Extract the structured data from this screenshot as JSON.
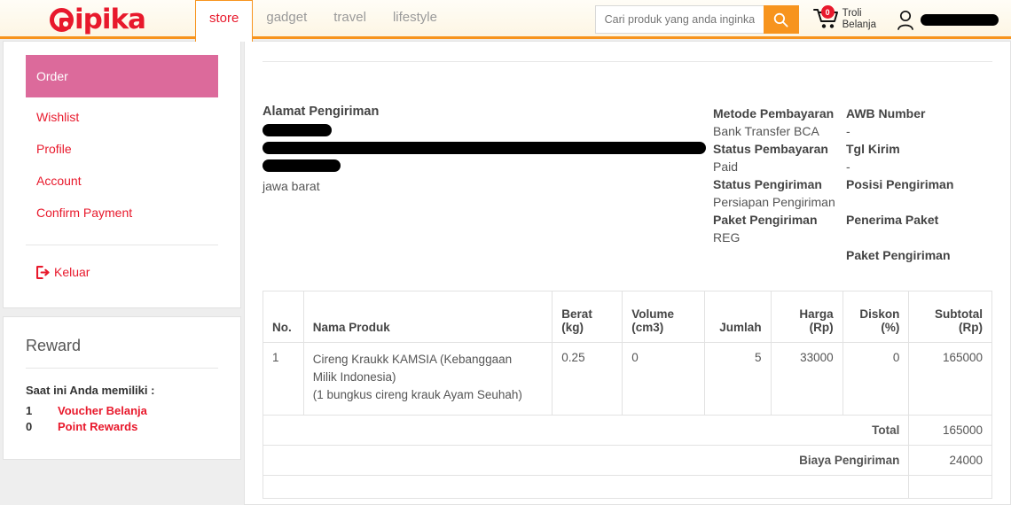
{
  "header": {
    "logo_text": "ipika",
    "nav": [
      {
        "label": "store",
        "active": true
      },
      {
        "label": "gadget",
        "active": false
      },
      {
        "label": "travel",
        "active": false
      },
      {
        "label": "lifestyle",
        "active": false
      }
    ],
    "search": {
      "placeholder": "Cari produk yang anda inginkan",
      "value": ""
    },
    "cart": {
      "count": "0",
      "label_line1": "Troli",
      "label_line2": "Belanja"
    },
    "user": {
      "name": ""
    },
    "colors": {
      "orange": "#f7941e",
      "red": "#e8192c",
      "pink": "#dc6a9b"
    }
  },
  "sidebar": {
    "items": [
      {
        "label": "Order"
      },
      {
        "label": "Wishlist"
      },
      {
        "label": "Profile"
      },
      {
        "label": "Account"
      },
      {
        "label": "Confirm Payment"
      }
    ],
    "logout_label": "Keluar",
    "reward": {
      "title": "Reward",
      "subtitle": "Saat ini Anda memiliki :",
      "rows": [
        {
          "count": "1",
          "label": "Voucher Belanja"
        },
        {
          "count": "0",
          "label": "Point Rewards"
        }
      ]
    }
  },
  "main": {
    "address": {
      "title": "Alamat Pengiriman",
      "province": "jawa barat"
    },
    "meta_left": [
      {
        "key": "Metode Pembayaran",
        "value": "Bank Transfer BCA"
      },
      {
        "key": "Status Pembayaran",
        "value": "Paid"
      },
      {
        "key": "Status Pengiriman",
        "value": "Persiapan Pengiriman"
      },
      {
        "key": "Paket Pengiriman",
        "value": "REG"
      }
    ],
    "meta_right": [
      {
        "key": "AWB Number",
        "value": "-"
      },
      {
        "key": "Tgl Kirim",
        "value": "-"
      },
      {
        "key": "Posisi Pengiriman",
        "value": ""
      },
      {
        "key": "Penerima Paket",
        "value": ""
      },
      {
        "key": "Paket Pengiriman",
        "value": ""
      }
    ],
    "table": {
      "headers": {
        "no": "No.",
        "nama": "Nama Produk",
        "berat_l1": "Berat",
        "berat_l2": "(kg)",
        "volume_l1": "Volume",
        "volume_l2": "(cm3)",
        "jumlah": "Jumlah",
        "harga_l1": "Harga",
        "harga_l2": "(Rp)",
        "diskon_l1": "Diskon",
        "diskon_l2": "(%)",
        "subtotal_l1": "Subtotal",
        "subtotal_l2": "(Rp)"
      },
      "rows": [
        {
          "no": "1",
          "nama_l1": "Cireng Kraukk KAMSIA (Kebanggaan",
          "nama_l2": "Milik Indonesia)",
          "nama_l3": "(1 bungkus cireng krauk Ayam Seuhah)",
          "berat": "0.25",
          "volume": "0",
          "jumlah": "5",
          "harga": "33000",
          "diskon": "0",
          "subtotal": "165000"
        }
      ],
      "summary": [
        {
          "label": "Total",
          "value": "165000"
        },
        {
          "label": "Biaya Pengiriman",
          "value": "24000"
        }
      ]
    }
  }
}
